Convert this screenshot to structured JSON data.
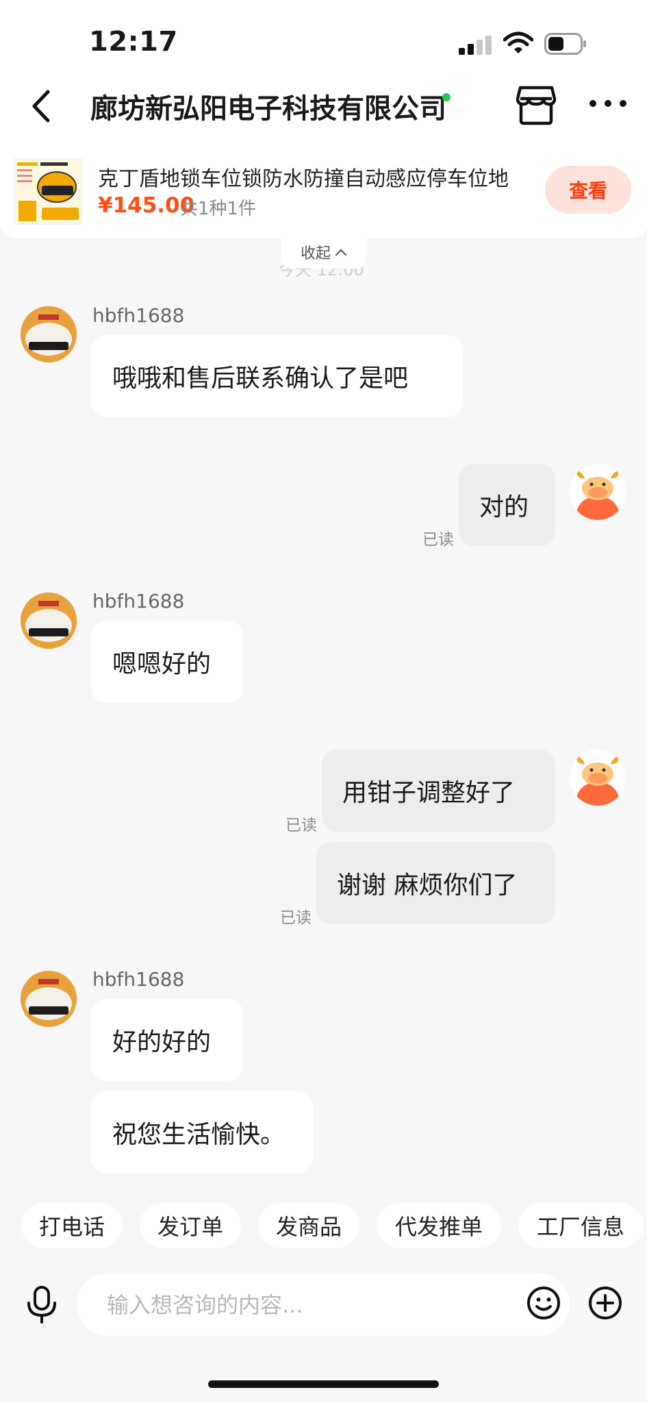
{
  "status_bar": {
    "time": "12:17"
  },
  "header": {
    "title": "廊坊新弘阳电子科技有限公司"
  },
  "product": {
    "title": "克丁盾地锁车位锁防水防撞自动感应停车位地",
    "price": "¥145.00",
    "quantity": "共1种1件",
    "view_label": "查看"
  },
  "collapse": {
    "label": "收起",
    "time_partial": "今天 12:00"
  },
  "messages": [
    {
      "sender": "hbfh1688",
      "text": "哦哦和售后联系确认了是吧"
    },
    {
      "text": "对的",
      "read": "已读"
    },
    {
      "sender": "hbfh1688",
      "text": "嗯嗯好的"
    },
    {
      "text": "用钳子调整好了",
      "read": "已读"
    },
    {
      "text": "谢谢 麻烦你们了",
      "read": "已读"
    },
    {
      "sender": "hbfh1688",
      "text": "好的好的"
    },
    {
      "text": "祝您生活愉快。"
    }
  ],
  "quick_actions": [
    "打电话",
    "发订单",
    "发商品",
    "代发推单",
    "工厂信息"
  ],
  "input": {
    "placeholder": "输入想咨询的内容..."
  },
  "colors": {
    "accent": "#ff4d14",
    "online": "#2dc653",
    "avatar_orange": "#ff6a3d"
  }
}
